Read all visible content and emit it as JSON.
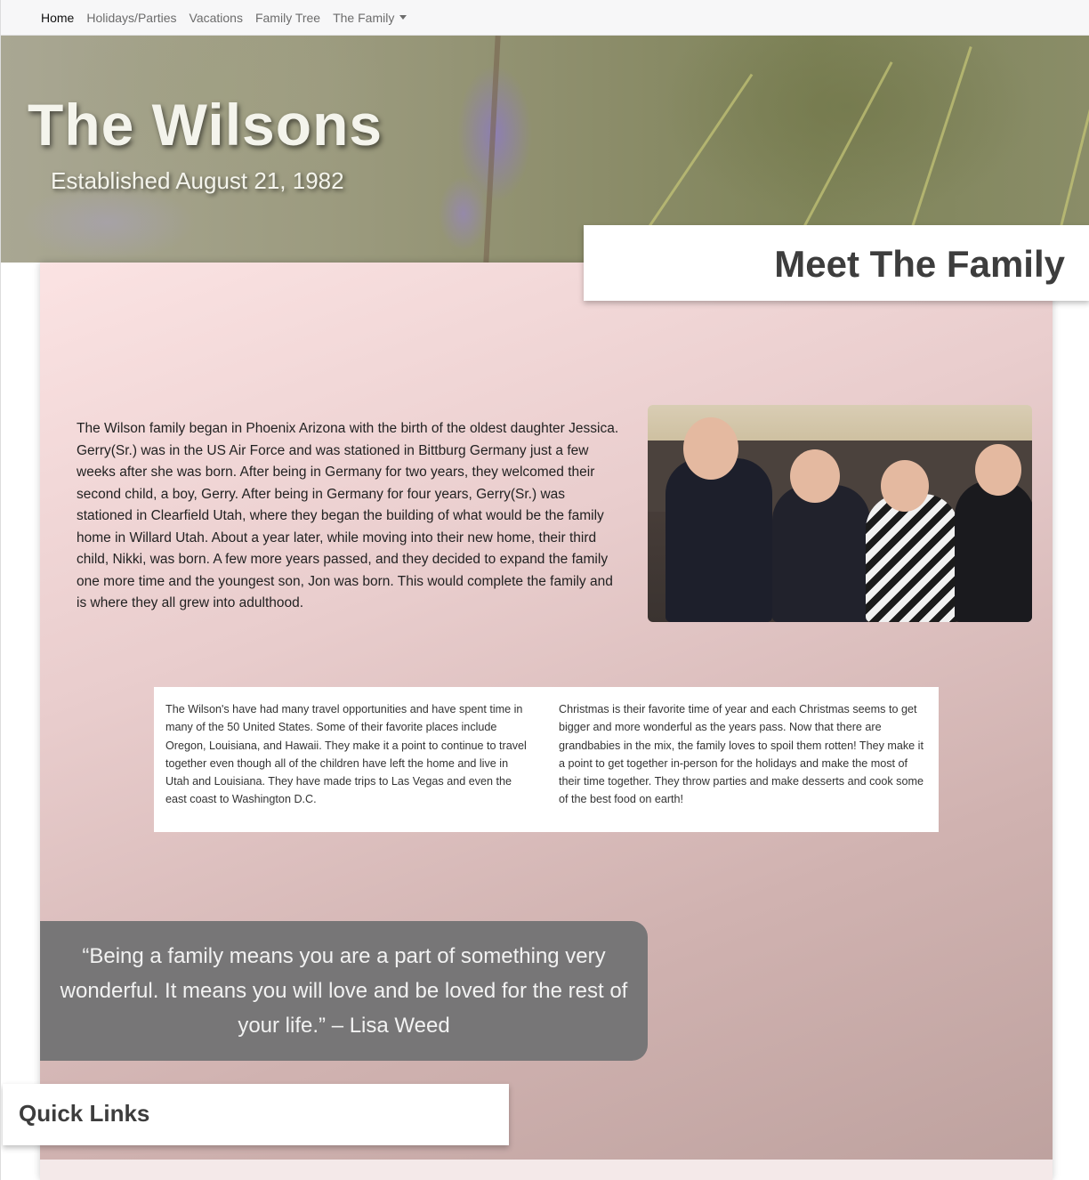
{
  "nav": {
    "items": [
      {
        "label": "Home",
        "active": true
      },
      {
        "label": "Holidays/Parties",
        "active": false
      },
      {
        "label": "Vacations",
        "active": false
      },
      {
        "label": "Family Tree",
        "active": false
      }
    ],
    "dropdown_label": "The Family",
    "dropdown_icon": "caret-down-icon"
  },
  "hero": {
    "title": "The Wilsons",
    "subtitle": "Established August 21, 1982"
  },
  "meet": {
    "title": "Meet The Family"
  },
  "intro": {
    "text": "The Wilson family began in Phoenix Arizona with the birth of the oldest daughter Jessica. Gerry(Sr.) was in the US Air Force and was stationed in Bittburg Germany just a few weeks after she was born. After being in Germany for two years, they welcomed their second child, a boy, Gerry. After being in Germany for four years, Gerry(Sr.) was stationed in Clearfield Utah, where they began the building of what would be the family home in Willard Utah. About a year later, while moving into their new home, their third child, Nikki, was born. A few more years passed, and they decided to expand the family one more time and the youngest son, Jon was born. This would complete the family and is where they all grew into adulthood."
  },
  "info": {
    "travel": "The Wilson's have had many travel opportunities and have spent time in many of the 50 United States. Some of their favorite places include Oregon, Louisiana, and Hawaii. They make it a point to continue to travel together even though all of the children have left the home and live in Utah and Louisiana. They have made trips to Las Vegas and even the east coast to Washington D.C.",
    "christmas": "Christmas is their favorite time of year and each Christmas seems to get bigger and more wonderful as the years pass. Now that there are grandbabies in the mix, the family loves to spoil them rotten! They make it a point to get together in-person for the holidays and make the most of their time together. They throw parties and make desserts and cook some of the best food on earth!"
  },
  "quote": {
    "text": "“Being a family means you are a part of something very wonderful. It means you will love and be loved for the rest of your life.” – Lisa Weed"
  },
  "quick_links": {
    "title": "Quick Links"
  },
  "colors": {
    "navbar_bg": "#f7f7f8",
    "panel_gradient_start": "#fbe3e3",
    "panel_gradient_end": "#bda19e",
    "quote_bg": "#777677"
  }
}
